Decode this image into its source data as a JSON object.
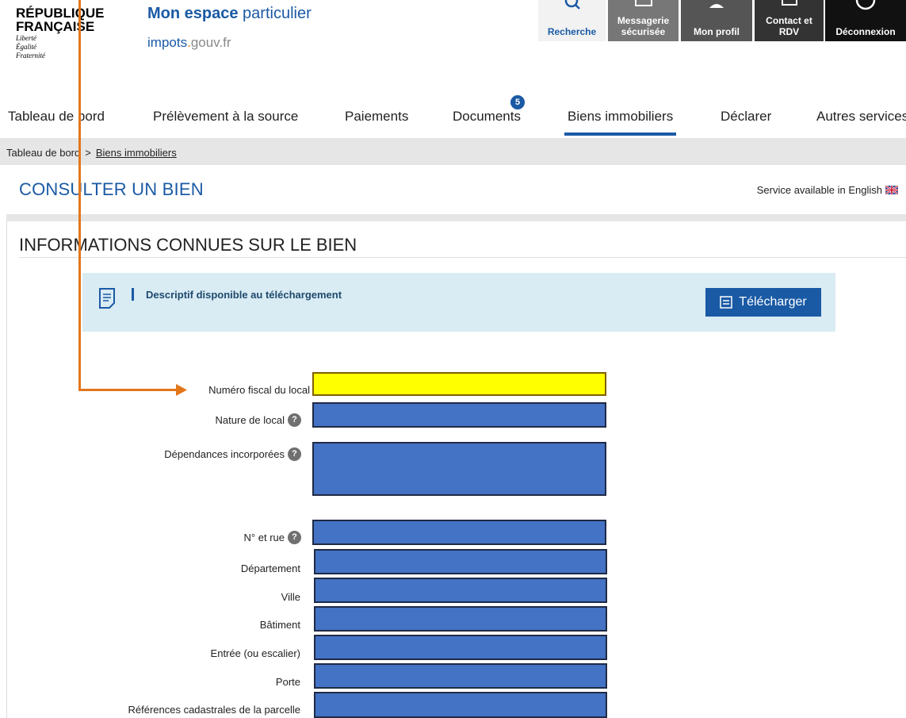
{
  "header": {
    "gov_title_line1": "RÉPUBLIQUE",
    "gov_title_line2": "FRANÇAISE",
    "motto_1": "Liberté",
    "motto_2": "Égalité",
    "motto_3": "Fraternité",
    "site_name_bold": "Mon espace",
    "site_name_light": "particulier",
    "site_domain_a": "impots",
    "site_domain_dot": ".",
    "site_domain_b": "gouv.fr",
    "buttons": {
      "search": "Recherche",
      "messaging_1": "Messagerie",
      "messaging_2": "sécurisée",
      "profile": "Mon profil",
      "contact_1": "Contact et",
      "contact_2": "RDV",
      "logout": "Déconnexion"
    }
  },
  "nav": {
    "items": [
      {
        "label": "Tableau de bord"
      },
      {
        "label": "Prélèvement à la source"
      },
      {
        "label": "Paiements"
      },
      {
        "label": "Documents"
      },
      {
        "label": "Biens immobiliers"
      },
      {
        "label": "Déclarer"
      },
      {
        "label": "Autres services"
      }
    ],
    "documents_badge": "5",
    "active": "Biens immobiliers"
  },
  "breadcrumb": {
    "home": "Tableau de bord",
    "separator": ">",
    "current": "Biens immobiliers"
  },
  "page": {
    "title": "CONSULTER UN BIEN",
    "english_link": "Service available in English"
  },
  "section": {
    "title": "INFORMATIONS CONNUES SUR LE BIEN",
    "info_text": "Descriptif disponible au téléchargement",
    "download_button": "Télécharger"
  },
  "form": {
    "labels": {
      "numero_fiscal": "Numéro fiscal du local",
      "nature": "Nature de local",
      "dependances": "Dépendances incorporées",
      "rue": "N° et rue",
      "departement": "Département",
      "ville": "Ville",
      "batiment": "Bâtiment",
      "entree": "Entrée (ou escalier)",
      "porte": "Porte",
      "references": "Références cadastrales de la parcelle"
    },
    "help_glyph": "?"
  },
  "colors": {
    "accent": "#1a5aa5",
    "annotation": "#e2761b",
    "highlight": "#ffff00",
    "redacted": "#4472c4"
  }
}
